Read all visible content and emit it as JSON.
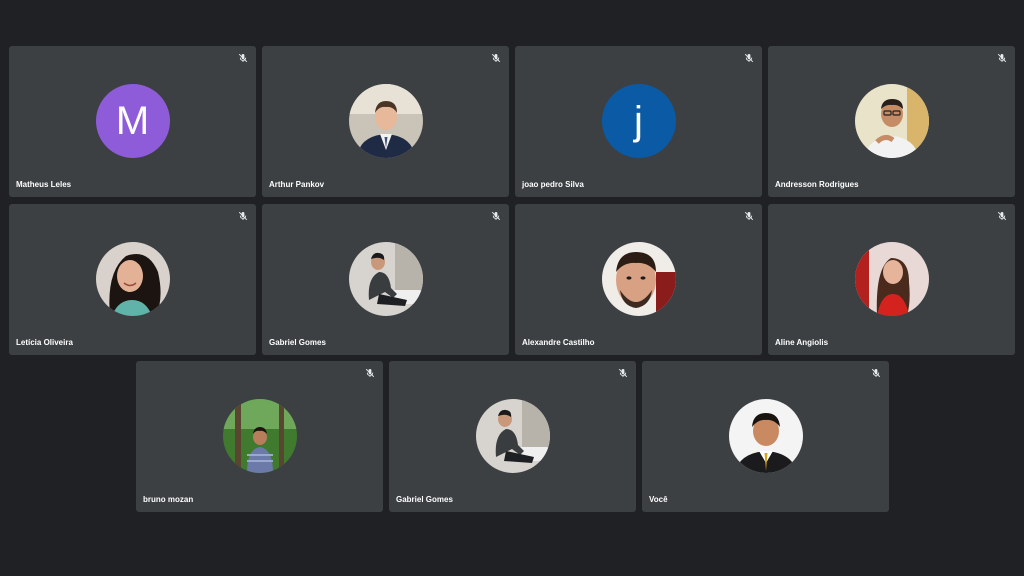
{
  "meeting": {
    "colors": {
      "background": "#202124",
      "tile": "#3c4043",
      "name_text": "#ffffff"
    },
    "participants": [
      {
        "name": "Matheus Leles",
        "avatar_type": "initial",
        "initial": "M",
        "avatar_color": "#8e5cd9",
        "muted": true
      },
      {
        "name": "Arthur Pankov",
        "avatar_type": "photo",
        "muted": true
      },
      {
        "name": "joao pedro Silva",
        "avatar_type": "initial",
        "initial": "j",
        "avatar_color": "#0b5aa6",
        "muted": true
      },
      {
        "name": "Andresson Rodrigues",
        "avatar_type": "photo",
        "muted": true
      },
      {
        "name": "Letícia Oliveira",
        "avatar_type": "photo",
        "muted": true
      },
      {
        "name": "Gabriel Gomes",
        "avatar_type": "photo",
        "muted": true
      },
      {
        "name": "Alexandre Castilho",
        "avatar_type": "photo",
        "muted": true
      },
      {
        "name": "Aline Angiolis",
        "avatar_type": "photo",
        "muted": true
      },
      {
        "name": "bruno mozan",
        "avatar_type": "photo",
        "muted": true
      },
      {
        "name": "Gabriel Gomes",
        "avatar_type": "photo",
        "muted": true
      },
      {
        "name": "Você",
        "avatar_type": "photo",
        "muted": true
      }
    ]
  }
}
